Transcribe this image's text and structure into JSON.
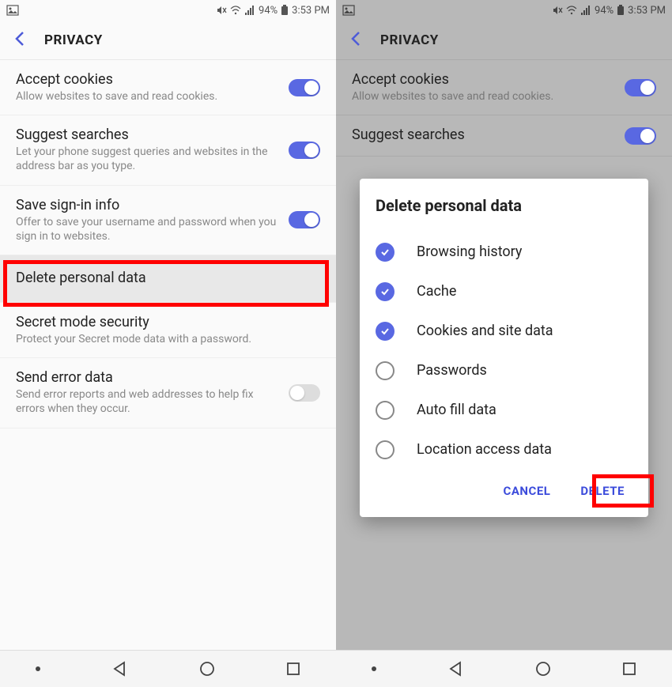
{
  "status": {
    "battery_percent": "94%",
    "time": "3:53 PM"
  },
  "header": {
    "title": "PRIVACY"
  },
  "settings": {
    "accept_cookies": {
      "title": "Accept cookies",
      "desc": "Allow websites to save and read cookies."
    },
    "suggest_searches": {
      "title": "Suggest searches",
      "desc": "Let your phone suggest queries and websites in the address bar as you type."
    },
    "save_signin": {
      "title": "Save sign-in info",
      "desc": "Offer to save your username and password when you sign in to websites."
    },
    "delete_personal": {
      "title": "Delete personal data"
    },
    "secret_mode": {
      "title": "Secret mode security",
      "desc": "Protect your Secret mode data with a password."
    },
    "send_error": {
      "title": "Send error data",
      "desc": "Send error reports and web addresses to help fix errors when they occur."
    }
  },
  "modal": {
    "title": "Delete personal data",
    "options": [
      {
        "label": "Browsing history",
        "checked": true
      },
      {
        "label": "Cache",
        "checked": true
      },
      {
        "label": "Cookies and site data",
        "checked": true
      },
      {
        "label": "Passwords",
        "checked": false
      },
      {
        "label": "Auto fill data",
        "checked": false
      },
      {
        "label": "Location access data",
        "checked": false
      }
    ],
    "cancel": "CANCEL",
    "delete": "DELETE"
  },
  "right_visible": {
    "suggest_partial": "Suggest searches",
    "s_letters": "S"
  }
}
